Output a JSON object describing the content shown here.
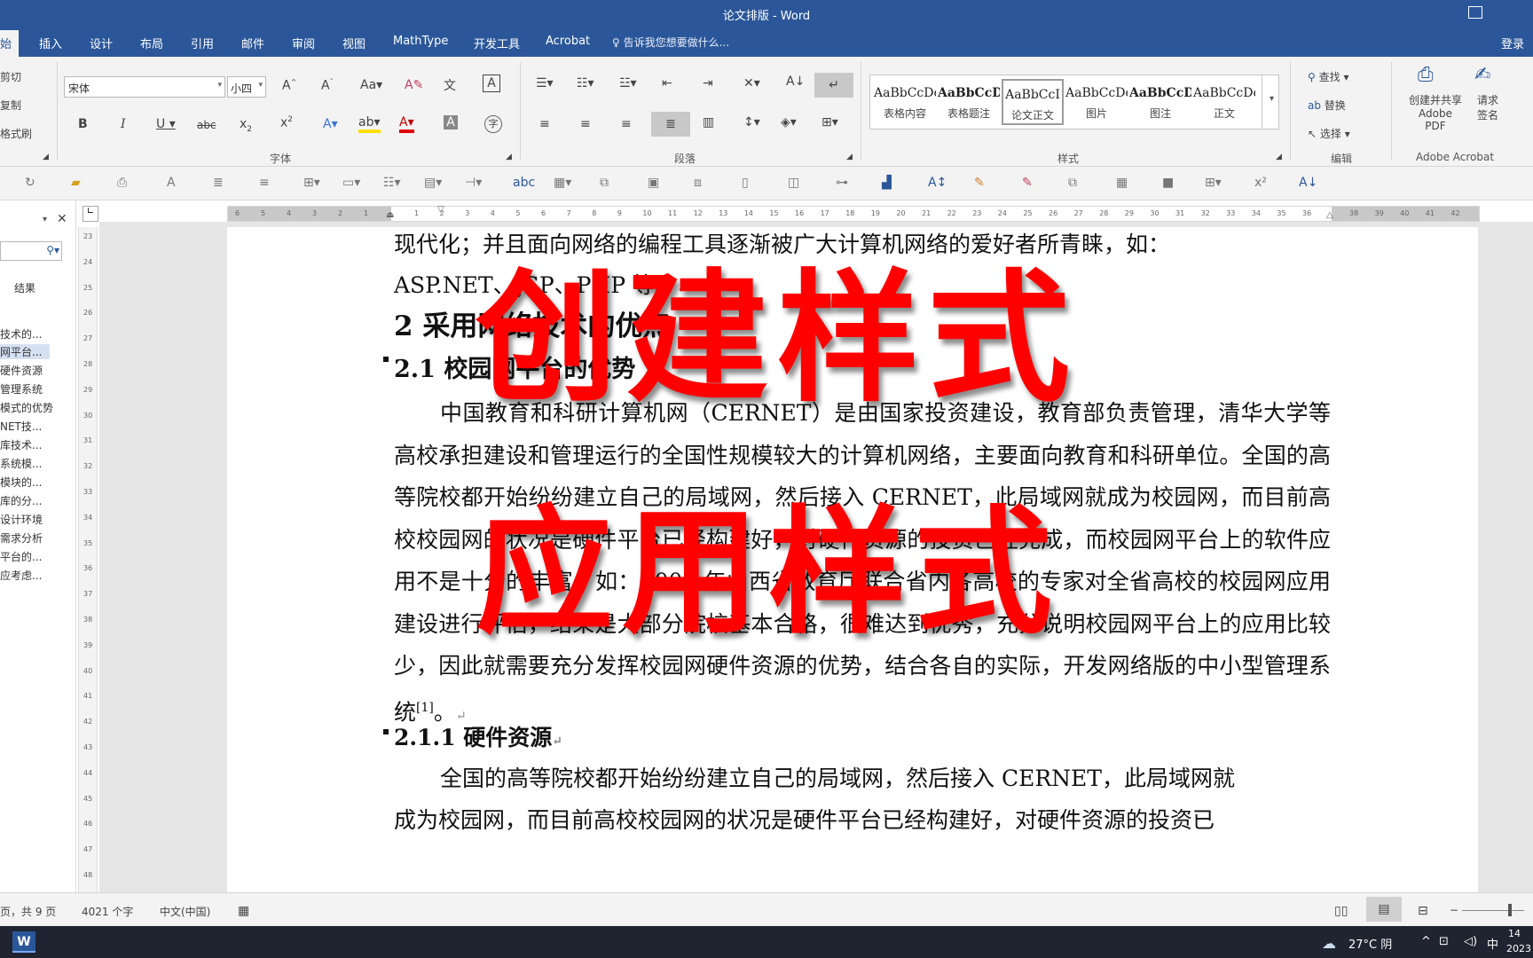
{
  "window": {
    "title": "论文排版 - Word"
  },
  "tabs": {
    "home": "始",
    "insert": "插入",
    "design": "设计",
    "layout": "布局",
    "references": "引用",
    "mailings": "邮件",
    "review": "审阅",
    "view": "视图",
    "mathtype": "MathType",
    "developer": "开发工具",
    "acrobat": "Acrobat",
    "tell_me": "告诉我您想要做什么...",
    "login": "登录"
  },
  "ribbon": {
    "clipboard": {
      "cut": "剪切",
      "copy": "复制",
      "format_painter": "格式刷"
    },
    "font": {
      "label": "字体",
      "name": "宋体",
      "size": "小四"
    },
    "paragraph": {
      "label": "段落"
    },
    "styles": {
      "label": "样式",
      "items": [
        {
          "preview": "AaBbCcDc",
          "name": "表格内容"
        },
        {
          "preview": "AaBbCcD",
          "name": "表格题注"
        },
        {
          "preview": "AaBbCcI",
          "name": "论文正文"
        },
        {
          "preview": "AaBbCcDc",
          "name": "图片"
        },
        {
          "preview": "AaBbCcD",
          "name": "图注"
        },
        {
          "preview": "AaBbCcDc",
          "name": "正文"
        }
      ]
    },
    "editing": {
      "label": "编辑",
      "find": "查找",
      "replace": "替换",
      "select": "选择"
    },
    "acrobat": {
      "label": "Adobe Acrobat",
      "create_share": "创建并共享",
      "adobe_pdf": "Adobe PDF",
      "request": "请求",
      "sign": "签名"
    }
  },
  "nav_pane": {
    "results": "结果",
    "items": [
      "技术的...",
      "网平台...",
      "硬件资源",
      "管理系统",
      "模式的优势",
      "NET技...",
      "库技术...",
      "系统模...",
      "模块的...",
      "库的分...",
      "设计环境",
      "需求分析",
      "平台的...",
      "应考虑..."
    ]
  },
  "vruler": [
    "23",
    "24",
    "25",
    "26",
    "27",
    "28",
    "29",
    "30",
    "31",
    "32",
    "33",
    "34",
    "35",
    "36",
    "37",
    "38",
    "39",
    "40",
    "41",
    "42",
    "43",
    "44",
    "45",
    "46",
    "47",
    "48"
  ],
  "hruler_left": [
    "6",
    "5",
    "4",
    "3",
    "2",
    "1"
  ],
  "hruler": [
    "1",
    "2",
    "3",
    "4",
    "5",
    "6",
    "7",
    "8",
    "9",
    "10",
    "11",
    "12",
    "13",
    "14",
    "15",
    "16",
    "17",
    "18",
    "19",
    "20",
    "21",
    "22",
    "23",
    "24",
    "25",
    "26",
    "27",
    "28",
    "29",
    "30",
    "31",
    "32",
    "33",
    "34",
    "35",
    "36"
  ],
  "hruler_right": [
    "38",
    "39",
    "40",
    "41",
    "42"
  ],
  "document": {
    "para1_line1": "现代化；并且面向网络的编程工具逐渐被广大计算机网络的爱好者所青睐，如：",
    "para1_line2": "ASP.NET、JSP、PHP 等。",
    "heading2": "2 采用网络技术的优点",
    "heading21": "2.1 校园网平台的优势",
    "para2": "中国教育和科研计算机网（CERNET）是由国家投资建设，教育部负责管理，清华大学等高校承担建设和管理运行的全国性规模较大的计算机网络，主要面向教育和科研单位。全国的高等院校都开始纷纷建立自己的局域网，然后接入 CERNET，此局域网就成为校园网，而目前高校校园网的状况是硬件平台已经构建好，对硬件资源的投资已经完成，而校园网平台上的软件应用不是十分的丰富，如：2005 年山西省教育厅联合省内各高校的专家对全省高校的校园网应用建设进行评估，结果是大部分院校基本合格，很难达到优秀，充分说明校园网平台上的应用比较少，因此就需要充分发挥校园网硬件资源的优势，结合各自的实际，开发网络版的中小型管理系统",
    "para2_ref": "[1]",
    "para2_end": "。",
    "heading211": "2.1.1 硬件资源",
    "para3_line1": "全国的高等院校都开始纷纷建立自己的局域网，然后接入 CERNET，此局域网就",
    "para3_line2": "成为校园网，而目前高校校园网的状况是硬件平台已经构建好，对硬件资源的投资已"
  },
  "overlay": {
    "text1": "创建样式",
    "text2": "应用样式",
    "color": "#ff0000"
  },
  "status": {
    "page": "页，共 9 页",
    "words": "4021 个字",
    "language": "中文(中国)"
  },
  "taskbar": {
    "weather": "27°C 阴",
    "ime": "中",
    "time": "14",
    "date": "2023"
  }
}
